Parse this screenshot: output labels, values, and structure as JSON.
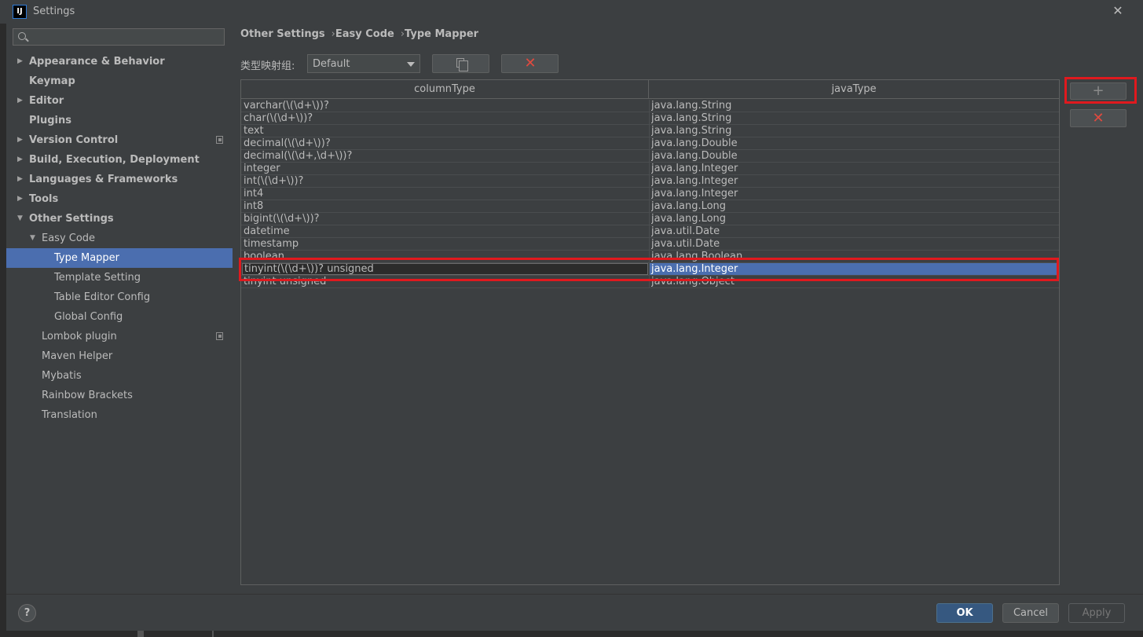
{
  "window": {
    "title": "Settings",
    "app_icon": "IJ"
  },
  "search": {
    "placeholder": ""
  },
  "sidebar": {
    "items": [
      {
        "label": "Appearance & Behavior",
        "arrow": "▶",
        "bold": true
      },
      {
        "label": "Keymap",
        "bold": true
      },
      {
        "label": "Editor",
        "arrow": "▶",
        "bold": true
      },
      {
        "label": "Plugins",
        "bold": true
      },
      {
        "label": "Version Control",
        "arrow": "▶",
        "bold": true,
        "copy_icon": true
      },
      {
        "label": "Build, Execution, Deployment",
        "arrow": "▶",
        "bold": true
      },
      {
        "label": "Languages & Frameworks",
        "arrow": "▶",
        "bold": true
      },
      {
        "label": "Tools",
        "arrow": "▶",
        "bold": true
      },
      {
        "label": "Other Settings",
        "arrow": "▼",
        "bold": true
      },
      {
        "label": "Easy Code",
        "arrow": "▼"
      },
      {
        "label": "Type Mapper",
        "selected": true
      },
      {
        "label": "Template Setting"
      },
      {
        "label": "Table Editor Config"
      },
      {
        "label": "Global Config"
      },
      {
        "label": "Lombok plugin",
        "copy_icon": true
      },
      {
        "label": "Maven Helper"
      },
      {
        "label": "Mybatis"
      },
      {
        "label": "Rainbow Brackets"
      },
      {
        "label": "Translation"
      }
    ]
  },
  "breadcrumb": {
    "part1": "Other Settings",
    "sep": "›",
    "part2": "Easy Code",
    "part3": "Type Mapper"
  },
  "type_group": {
    "label": "类型映射组:",
    "value": "Default"
  },
  "table": {
    "headers": {
      "column_type": "columnType",
      "java_type": "javaType"
    },
    "rows": [
      {
        "columnType": "varchar(\\(\\d+\\))?",
        "javaType": "java.lang.String"
      },
      {
        "columnType": "char(\\(\\d+\\))?",
        "javaType": "java.lang.String"
      },
      {
        "columnType": "text",
        "javaType": "java.lang.String"
      },
      {
        "columnType": "decimal(\\(\\d+\\))?",
        "javaType": "java.lang.Double"
      },
      {
        "columnType": "decimal(\\(\\d+,\\d+\\))?",
        "javaType": "java.lang.Double"
      },
      {
        "columnType": "integer",
        "javaType": "java.lang.Integer"
      },
      {
        "columnType": "int(\\(\\d+\\))?",
        "javaType": "java.lang.Integer"
      },
      {
        "columnType": "int4",
        "javaType": "java.lang.Integer"
      },
      {
        "columnType": "int8",
        "javaType": "java.lang.Long"
      },
      {
        "columnType": "bigint(\\(\\d+\\))?",
        "javaType": "java.lang.Long"
      },
      {
        "columnType": "datetime",
        "javaType": "java.util.Date"
      },
      {
        "columnType": "timestamp",
        "javaType": "java.util.Date"
      },
      {
        "columnType": "boolean",
        "javaType": "java.lang.Boolean"
      },
      {
        "columnType": "tinyint(\\(\\d+\\))? unsigned",
        "javaType": "java.lang.Integer",
        "selected": true
      },
      {
        "columnType": "tinyint unsigned",
        "javaType": "java.lang.Object"
      }
    ]
  },
  "side_buttons": {
    "add": "+",
    "remove": "✕"
  },
  "toolbar": {
    "copy_icon": "copy-icon",
    "delete": "✕"
  },
  "footer": {
    "help": "?",
    "ok": "OK",
    "cancel": "Cancel",
    "apply": "Apply"
  },
  "colors": {
    "background": "#3c3f41",
    "selection": "#4b6eaf",
    "delete_red": "#e04a3f",
    "annotation_red": "#e0191e"
  }
}
